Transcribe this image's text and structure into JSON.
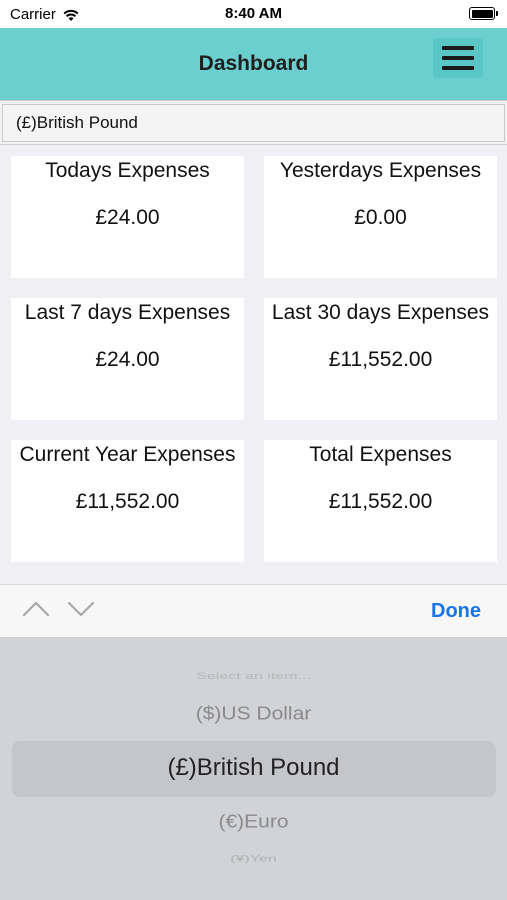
{
  "status_bar": {
    "carrier": "Carrier",
    "time": "8:40 AM",
    "icons": [
      "wifi-icon",
      "battery-icon"
    ]
  },
  "nav": {
    "title": "Dashboard",
    "menu_icon": "hamburger-menu-icon",
    "color": "#6ccfcf"
  },
  "currency": {
    "selected": "(£)British Pound"
  },
  "cards": {
    "today": {
      "title": "Todays Expenses",
      "value": "£24.00"
    },
    "yesterday": {
      "title": "Yesterdays Expenses",
      "value": "£0.00"
    },
    "last7": {
      "title": "Last 7 days Expenses",
      "value": "£24.00"
    },
    "last30": {
      "title": "Last 30 days Expenses",
      "value": "£11,552.00"
    },
    "current_year": {
      "title": "Current Year Expenses",
      "value": "£11,552.00"
    },
    "total": {
      "title": "Total Expenses",
      "value": "£11,552.00"
    }
  },
  "picker_toolbar": {
    "prev_icon": "chevron-up-icon",
    "next_icon": "chevron-down-icon",
    "done_label": "Done",
    "done_color": "#1a73e8"
  },
  "picker": {
    "options": [
      "Select an item...",
      "($)US Dollar",
      "(£)British Pound",
      "(€)Euro",
      "(¥)Yen"
    ],
    "selected": "(£)British Pound"
  }
}
